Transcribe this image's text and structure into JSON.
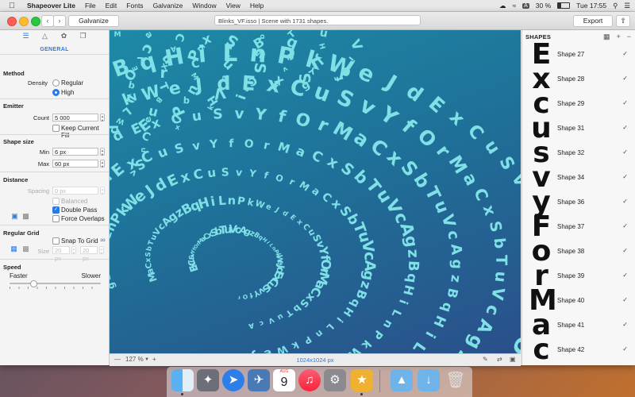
{
  "menubar": {
    "app_name": "Shapeover Lite",
    "items": [
      "File",
      "Edit",
      "Fonts",
      "Galvanize",
      "Window",
      "View",
      "Help"
    ],
    "status_a": "A",
    "battery": "30 %",
    "clock": "Tue 17:55"
  },
  "toolbar": {
    "galvanize_label": "Galvanize",
    "document_field": "Blinks_VF.isso | Scene with 1731 shapes.",
    "export_label": "Export"
  },
  "inspector": {
    "tab_title": "GENERAL",
    "method": {
      "title": "Method",
      "density_label": "Density",
      "options": [
        "Regular",
        "High"
      ],
      "selected": "High"
    },
    "emitter": {
      "title": "Emitter",
      "count_label": "Count",
      "count_value": "5 000",
      "keep_current_fill": "Keep Current Fill"
    },
    "shape_size": {
      "title": "Shape size",
      "min_label": "Min",
      "min_value": "6 px",
      "max_label": "Max",
      "max_value": "60 px"
    },
    "distance": {
      "title": "Distance",
      "spacing_label": "Spacing",
      "spacing_value": "0 px",
      "balanced": "Balanced",
      "double_pass": "Double Pass",
      "force_overlaps": "Force Overlaps"
    },
    "regular_grid": {
      "title": "Regular Grid",
      "snap_to_grid": "Snap To Grid",
      "size_label": "Size",
      "size_x": "20 px",
      "size_y": "20 px"
    },
    "speed": {
      "title": "Speed",
      "faster": "Faster",
      "slower": "Slower",
      "level": 0.25
    }
  },
  "canvas": {
    "zoom": "127 %",
    "image_size": "1024x1024 px",
    "letters": "ExCuSvYfOrMaCxSbTuVcAgzBqHiLnPkWeJd"
  },
  "shapes_panel": {
    "title": "SHAPES",
    "items": [
      {
        "glyph": "E",
        "name": "Shape 27"
      },
      {
        "glyph": "x",
        "name": "Shape 28"
      },
      {
        "glyph": "c",
        "name": "Shape 29"
      },
      {
        "glyph": "u",
        "name": "Shape 31"
      },
      {
        "glyph": "s",
        "name": "Shape 32"
      },
      {
        "glyph": "v",
        "name": "Shape 34"
      },
      {
        "glyph": "y",
        "name": "Shape 36"
      },
      {
        "glyph": "F",
        "name": "Shape 37"
      },
      {
        "glyph": "o",
        "name": "Shape 38"
      },
      {
        "glyph": "r",
        "name": "Shape 39"
      },
      {
        "glyph": "M",
        "name": "Shape 40"
      },
      {
        "glyph": "a",
        "name": "Shape 41"
      },
      {
        "glyph": "c",
        "name": "Shape 42"
      }
    ]
  },
  "dock": {
    "calendar_day": "9",
    "calendar_month": "AUG",
    "items": [
      "finder-icon",
      "launchpad-icon",
      "safari-icon",
      "preview-icon",
      "calendar-icon",
      "music-icon",
      "system-preferences-icon",
      "shapeover-icon",
      "applications-folder-icon",
      "downloads-folder-icon",
      "trash-icon"
    ]
  },
  "colors": {
    "accent": "#2a7ae2",
    "canvas_top": "#1d8aa6",
    "canvas_bottom": "#2a4f8a",
    "letters": "#7fe0e6"
  }
}
